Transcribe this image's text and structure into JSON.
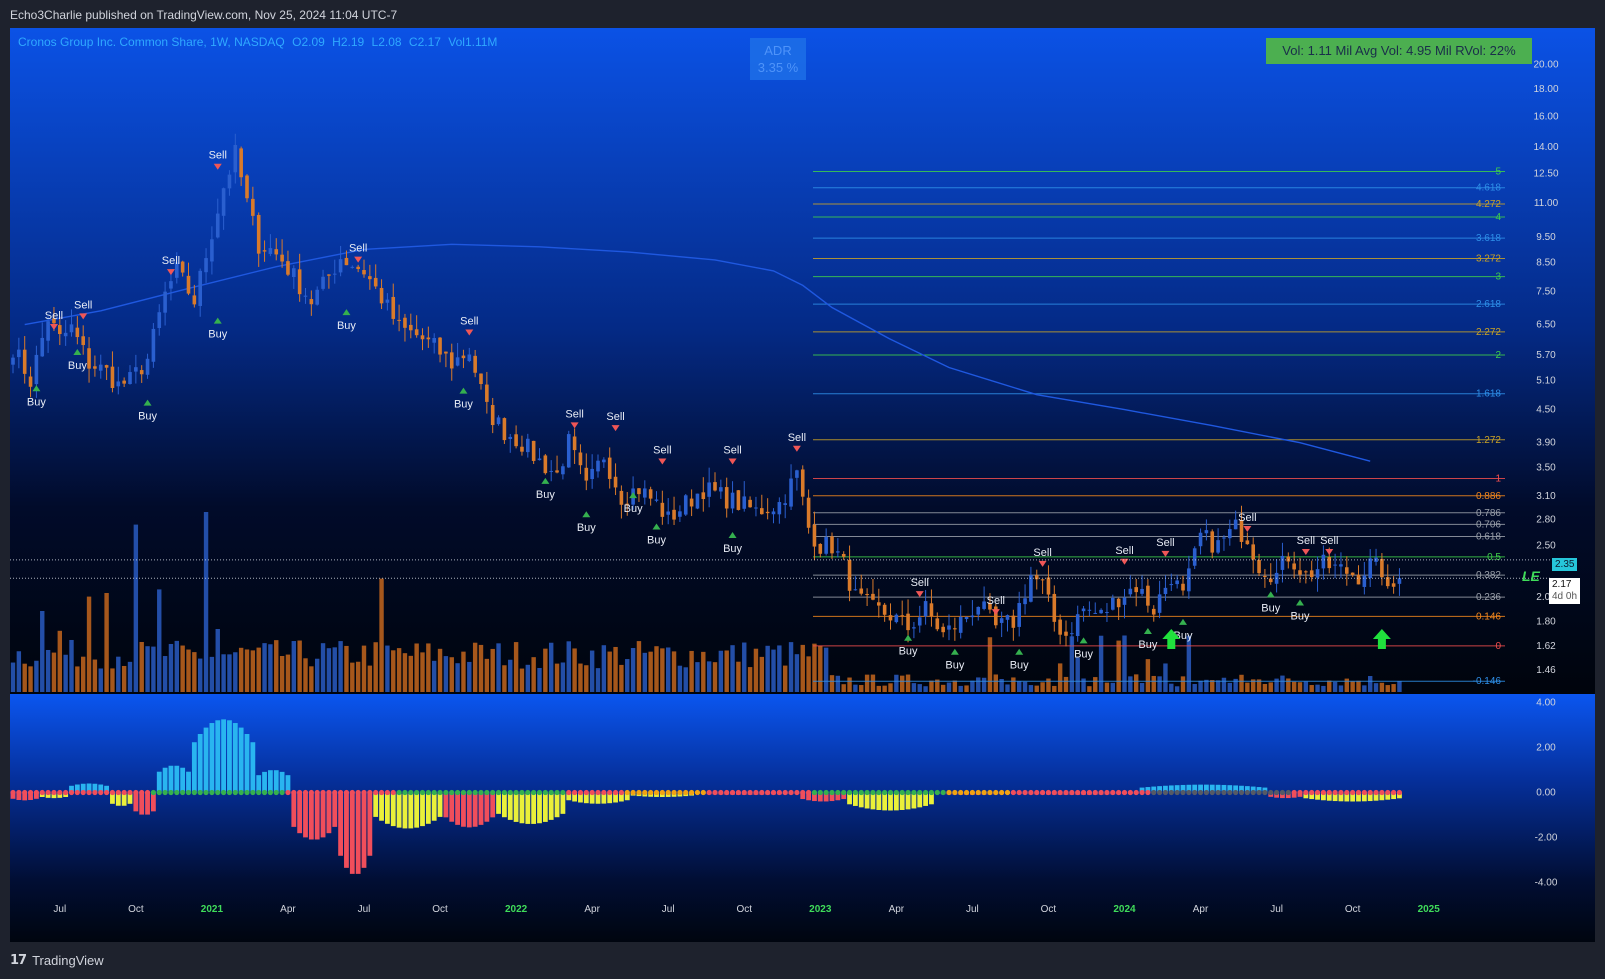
{
  "header": {
    "publisher": "Echo3Charlie published on TradingView.com, Nov 25, 2024 11:04 UTC-7"
  },
  "legend": {
    "symbol": "Cronos Group Inc. Common Share, 1W, NASDAQ",
    "open": "O2.09",
    "high": "H2.19",
    "low": "L2.08",
    "close": "C2.17",
    "volume": "Vol1.11M"
  },
  "adr": {
    "label": "ADR",
    "value": "3.35 %"
  },
  "volume_box": "Vol: 1.11 Mil   Avg Vol: 4.95 Mil   RVol: 22%",
  "footer": {
    "brand_logo": "17",
    "brand_name": "TradingView"
  },
  "price_badges": {
    "upper": "2.35",
    "last": "2.17",
    "countdown": "4d 0h",
    "le": "LE"
  },
  "colors": {
    "background_top": "#0b4fe3",
    "background_bottom": "#00050f",
    "bull": "#2a5fcf",
    "bear": "#d97a2a",
    "ma": "#1f58e0",
    "sell_marker": "#f05656",
    "buy_marker": "#35b04f",
    "hist_blue": "#29b5f0",
    "hist_red": "#f04e5b",
    "hist_yellow": "#eaf03a"
  },
  "chart_data": [
    {
      "type": "candlestick",
      "title": "Cronos Group Inc. Common Share, 1W, NASDAQ",
      "y_scale": "log",
      "ylim": [
        1.35,
        21.5
      ],
      "y_ticks": [
        "20.00",
        "18.00",
        "16.00",
        "14.00",
        "12.50",
        "11.00",
        "9.50",
        "8.50",
        "7.50",
        "6.50",
        "5.70",
        "5.10",
        "4.50",
        "3.90",
        "3.50",
        "3.10",
        "2.80",
        "2.50",
        "2.00",
        "1.80",
        "1.62",
        "1.46"
      ],
      "x_ticks": [
        {
          "label": "Jul",
          "week": 8,
          "year": false
        },
        {
          "label": "Oct",
          "week": 21,
          "year": false
        },
        {
          "label": "2021",
          "week": 34,
          "year": true
        },
        {
          "label": "Apr",
          "week": 47,
          "year": false
        },
        {
          "label": "Jul",
          "week": 60,
          "year": false
        },
        {
          "label": "Oct",
          "week": 73,
          "year": false
        },
        {
          "label": "2022",
          "week": 86,
          "year": true
        },
        {
          "label": "Apr",
          "week": 99,
          "year": false
        },
        {
          "label": "Jul",
          "week": 112,
          "year": false
        },
        {
          "label": "Oct",
          "week": 125,
          "year": false
        },
        {
          "label": "2023",
          "week": 138,
          "year": true
        },
        {
          "label": "Apr",
          "week": 151,
          "year": false
        },
        {
          "label": "Jul",
          "week": 164,
          "year": false
        },
        {
          "label": "Oct",
          "week": 177,
          "year": false
        },
        {
          "label": "2024",
          "week": 190,
          "year": true
        },
        {
          "label": "Apr",
          "week": 203,
          "year": false
        },
        {
          "label": "Jul",
          "week": 216,
          "year": false
        },
        {
          "label": "Oct",
          "week": 229,
          "year": false
        },
        {
          "label": "2025",
          "week": 242,
          "year": true
        }
      ],
      "anchors": [
        [
          0,
          5.9
        ],
        [
          3,
          5.1
        ],
        [
          6,
          6.7
        ],
        [
          8,
          6.1
        ],
        [
          10,
          6.4
        ],
        [
          13,
          5.5
        ],
        [
          16,
          5.3
        ],
        [
          18,
          5.0
        ],
        [
          20,
          5.1
        ],
        [
          23,
          5.6
        ],
        [
          26,
          7.4
        ],
        [
          28,
          8.2
        ],
        [
          31,
          7.2
        ],
        [
          33,
          8.8
        ],
        [
          36,
          11.8
        ],
        [
          38,
          13.6
        ],
        [
          40,
          11.0
        ],
        [
          42,
          9.2
        ],
        [
          44,
          9.0
        ],
        [
          46,
          8.6
        ],
        [
          48,
          8.0
        ],
        [
          51,
          7.2
        ],
        [
          53,
          7.7
        ],
        [
          56,
          8.7
        ],
        [
          60,
          8.2
        ],
        [
          63,
          7.3
        ],
        [
          66,
          6.4
        ],
        [
          69,
          6.2
        ],
        [
          72,
          5.9
        ],
        [
          75,
          5.5
        ],
        [
          78,
          5.8
        ],
        [
          81,
          4.5
        ],
        [
          84,
          4.1
        ],
        [
          87,
          3.9
        ],
        [
          90,
          3.6
        ],
        [
          93,
          3.4
        ],
        [
          95,
          3.9
        ],
        [
          98,
          3.2
        ],
        [
          101,
          3.7
        ],
        [
          104,
          3.1
        ],
        [
          107,
          3.2
        ],
        [
          110,
          3.0
        ],
        [
          112,
          2.8
        ],
        [
          115,
          3.0
        ],
        [
          118,
          3.2
        ],
        [
          121,
          3.1
        ],
        [
          124,
          3.0
        ],
        [
          127,
          2.9
        ],
        [
          131,
          3.0
        ],
        [
          134,
          3.4
        ],
        [
          136,
          2.7
        ],
        [
          138,
          2.5
        ],
        [
          140,
          2.5
        ],
        [
          142,
          2.3
        ],
        [
          144,
          2.0
        ],
        [
          147,
          1.9
        ],
        [
          150,
          1.85
        ],
        [
          153,
          1.75
        ],
        [
          156,
          1.9
        ],
        [
          159,
          1.7
        ],
        [
          162,
          1.8
        ],
        [
          165,
          1.95
        ],
        [
          168,
          1.75
        ],
        [
          171,
          1.8
        ],
        [
          174,
          2.2
        ],
        [
          176,
          2.1
        ],
        [
          178,
          1.8
        ],
        [
          180,
          1.7
        ],
        [
          183,
          1.9
        ],
        [
          186,
          1.85
        ],
        [
          189,
          2.0
        ],
        [
          192,
          2.1
        ],
        [
          195,
          1.9
        ],
        [
          198,
          2.2
        ],
        [
          200,
          2.0
        ],
        [
          203,
          2.6
        ],
        [
          206,
          2.5
        ],
        [
          209,
          2.7
        ],
        [
          211,
          2.6
        ],
        [
          213,
          2.3
        ],
        [
          216,
          2.2
        ],
        [
          218,
          2.4
        ],
        [
          221,
          2.2
        ],
        [
          224,
          2.3
        ],
        [
          227,
          2.25
        ],
        [
          230,
          2.2
        ],
        [
          232,
          2.3
        ],
        [
          234,
          2.25
        ],
        [
          235,
          2.02
        ],
        [
          236,
          2.09
        ],
        [
          237,
          2.17
        ]
      ],
      "last_close": 2.17,
      "markers": [
        {
          "type": "sell",
          "week": 7,
          "price": 6.35
        },
        {
          "type": "sell",
          "week": 12,
          "price": 6.65
        },
        {
          "type": "sell",
          "week": 27,
          "price": 8.05
        },
        {
          "type": "sell",
          "week": 35,
          "price": 12.7
        },
        {
          "type": "sell",
          "week": 59,
          "price": 8.5
        },
        {
          "type": "sell",
          "week": 78,
          "price": 6.2
        },
        {
          "type": "sell",
          "week": 96,
          "price": 4.15
        },
        {
          "type": "sell",
          "week": 103,
          "price": 4.1
        },
        {
          "type": "sell",
          "week": 111,
          "price": 3.55
        },
        {
          "type": "sell",
          "week": 123,
          "price": 3.55
        },
        {
          "type": "sell",
          "week": 134,
          "price": 3.75
        },
        {
          "type": "sell",
          "week": 155,
          "price": 2.0
        },
        {
          "type": "sell",
          "week": 168,
          "price": 1.85
        },
        {
          "type": "sell",
          "week": 176,
          "price": 2.28
        },
        {
          "type": "sell",
          "week": 190,
          "price": 2.3
        },
        {
          "type": "sell",
          "week": 197,
          "price": 2.38
        },
        {
          "type": "sell",
          "week": 211,
          "price": 2.65
        },
        {
          "type": "sell",
          "week": 221,
          "price": 2.4
        },
        {
          "type": "sell",
          "week": 225,
          "price": 2.4
        },
        {
          "type": "buy",
          "week": 4,
          "price": 5.0
        },
        {
          "type": "buy",
          "week": 11,
          "price": 5.85
        },
        {
          "type": "buy",
          "week": 23,
          "price": 4.7
        },
        {
          "type": "buy",
          "week": 35,
          "price": 6.7
        },
        {
          "type": "buy",
          "week": 57,
          "price": 6.95
        },
        {
          "type": "buy",
          "week": 77,
          "price": 4.95
        },
        {
          "type": "buy",
          "week": 91,
          "price": 3.35
        },
        {
          "type": "buy",
          "week": 98,
          "price": 2.9
        },
        {
          "type": "buy",
          "week": 106,
          "price": 3.15
        },
        {
          "type": "buy",
          "week": 110,
          "price": 2.75
        },
        {
          "type": "buy",
          "week": 123,
          "price": 2.65
        },
        {
          "type": "buy",
          "week": 153,
          "price": 1.7
        },
        {
          "type": "buy",
          "week": 161,
          "price": 1.6
        },
        {
          "type": "buy",
          "week": 172,
          "price": 1.6
        },
        {
          "type": "buy",
          "week": 183,
          "price": 1.68
        },
        {
          "type": "buy",
          "week": 194,
          "price": 1.75
        },
        {
          "type": "buy",
          "week": 200,
          "price": 1.82
        },
        {
          "type": "buy",
          "week": 215,
          "price": 2.05
        },
        {
          "type": "buy",
          "week": 220,
          "price": 1.98
        }
      ],
      "buy_arrows_big": [
        {
          "week": 198,
          "price": 1.64
        },
        {
          "week": 234,
          "price": 1.64
        }
      ],
      "moving_average": [
        [
          2,
          6.5
        ],
        [
          15,
          6.9
        ],
        [
          30,
          7.6
        ],
        [
          45,
          8.35
        ],
        [
          60,
          9.0
        ],
        [
          75,
          9.2
        ],
        [
          90,
          9.1
        ],
        [
          105,
          8.9
        ],
        [
          120,
          8.6
        ],
        [
          130,
          8.2
        ],
        [
          135,
          7.7
        ],
        [
          140,
          7.0
        ],
        [
          150,
          6.1
        ],
        [
          160,
          5.4
        ],
        [
          175,
          4.8
        ],
        [
          190,
          4.5
        ],
        [
          205,
          4.2
        ],
        [
          220,
          3.9
        ],
        [
          232,
          3.6
        ]
      ],
      "fib_levels": [
        {
          "label": "0",
          "price": 1.62,
          "color": "#f04e4e"
        },
        {
          "label": "0.146",
          "price": 1.84,
          "color": "#f2871d"
        },
        {
          "label": "0.236",
          "price": 2.0,
          "color": "#9aa0aa"
        },
        {
          "label": "0.382",
          "price": 2.2,
          "color": "#9aa0aa"
        },
        {
          "label": "0.5",
          "price": 2.38,
          "color": "#3fcf4a"
        },
        {
          "label": "0.618",
          "price": 2.6,
          "color": "#9aa0aa"
        },
        {
          "label": "0.706",
          "price": 2.74,
          "color": "#9aa0aa"
        },
        {
          "label": "0.786",
          "price": 2.88,
          "color": "#9aa0aa"
        },
        {
          "label": "0.886",
          "price": 3.1,
          "color": "#f2871d"
        },
        {
          "label": "1",
          "price": 3.34,
          "color": "#f04e4e"
        },
        {
          "label": "1.272",
          "price": 3.95,
          "color": "#c9a227"
        },
        {
          "label": "1.618",
          "price": 4.82,
          "color": "#2e8fe8"
        },
        {
          "label": "2",
          "price": 5.7,
          "color": "#3fcf4a"
        },
        {
          "label": "2.272",
          "price": 6.3,
          "color": "#c9a227"
        },
        {
          "label": "2.618",
          "price": 7.1,
          "color": "#2e8fe8"
        },
        {
          "label": "3",
          "price": 8.0,
          "color": "#3fcf4a"
        },
        {
          "label": "3.272",
          "price": 8.65,
          "color": "#c9a227"
        },
        {
          "label": "3.618",
          "price": 9.45,
          "color": "#2e8fe8"
        },
        {
          "label": "4",
          "price": 10.35,
          "color": "#3fcf4a"
        },
        {
          "label": "4.272",
          "price": 10.95,
          "color": "#c9a227"
        },
        {
          "label": "4.618",
          "price": 11.75,
          "color": "#2e8fe8"
        },
        {
          "label": "5",
          "price": 12.6,
          "color": "#3fcf4a"
        },
        {
          "label": "-0.146",
          "price": 1.39,
          "color": "#2e8fe8"
        }
      ],
      "volume_spikes": [
        [
          21,
          0.93
        ],
        [
          33,
          1.0
        ],
        [
          63,
          0.63
        ],
        [
          25,
          0.57
        ],
        [
          16,
          0.55
        ],
        [
          13,
          0.53
        ],
        [
          35,
          0.35
        ],
        [
          5,
          0.45
        ],
        [
          8,
          0.34
        ]
      ]
    },
    {
      "type": "histogram",
      "ylim": [
        -4.6,
        4.2
      ],
      "y_ticks": [
        "4.00",
        "2.00",
        "0.00",
        "-2.00",
        "-4.00"
      ],
      "segments": [
        {
          "from": 0,
          "to": 4,
          "color": "red",
          "val": -0.35
        },
        {
          "from": 5,
          "to": 9,
          "color": "yellow",
          "val": -0.25
        },
        {
          "from": 10,
          "to": 16,
          "color": "blue",
          "val": 0.4
        },
        {
          "from": 17,
          "to": 20,
          "color": "yellow",
          "val": -0.6
        },
        {
          "from": 21,
          "to": 24,
          "color": "red",
          "val": -1.0
        },
        {
          "from": 25,
          "to": 30,
          "color": "blue",
          "val": 1.2
        },
        {
          "from": 31,
          "to": 41,
          "color": "blue",
          "val": 3.25
        },
        {
          "from": 42,
          "to": 47,
          "color": "blue",
          "val": 1.0
        },
        {
          "from": 48,
          "to": 55,
          "color": "red",
          "val": -2.1
        },
        {
          "from": 56,
          "to": 61,
          "color": "red",
          "val": -3.65
        },
        {
          "from": 62,
          "to": 73,
          "color": "yellow",
          "val": -1.6
        },
        {
          "from": 74,
          "to": 82,
          "color": "red",
          "val": -1.55
        },
        {
          "from": 83,
          "to": 94,
          "color": "yellow",
          "val": -1.4
        },
        {
          "from": 95,
          "to": 105,
          "color": "yellow",
          "val": -0.5
        },
        {
          "from": 106,
          "to": 116,
          "color": "yellow",
          "val": -0.2
        },
        {
          "from": 117,
          "to": 134,
          "color": "red",
          "val": -0.1
        },
        {
          "from": 135,
          "to": 142,
          "color": "red",
          "val": -0.4
        },
        {
          "from": 143,
          "to": 157,
          "color": "yellow",
          "val": -0.8
        },
        {
          "from": 158,
          "to": 170,
          "color": "red",
          "val": -0.1
        },
        {
          "from": 171,
          "to": 192,
          "color": "red",
          "val": -0.1
        },
        {
          "from": 193,
          "to": 214,
          "color": "blue",
          "val": 0.35
        },
        {
          "from": 215,
          "to": 220,
          "color": "red",
          "val": -0.25
        },
        {
          "from": 221,
          "to": 237,
          "color": "yellow",
          "val": -0.4
        }
      ],
      "dots": [
        {
          "from": 0,
          "to": 23,
          "color": "#f04e5b"
        },
        {
          "from": 24,
          "to": 46,
          "color": "#35b04f"
        },
        {
          "from": 47,
          "to": 65,
          "color": "#f04e5b"
        },
        {
          "from": 66,
          "to": 94,
          "color": "#35b04f"
        },
        {
          "from": 95,
          "to": 104,
          "color": "#f04e5b"
        },
        {
          "from": 105,
          "to": 118,
          "color": "#f2a313"
        },
        {
          "from": 119,
          "to": 136,
          "color": "#f04e5b"
        },
        {
          "from": 137,
          "to": 159,
          "color": "#35b04f"
        },
        {
          "from": 160,
          "to": 170,
          "color": "#f2a313"
        },
        {
          "from": 171,
          "to": 194,
          "color": "#f04e5b"
        },
        {
          "from": 195,
          "to": 218,
          "color": "#555a66"
        },
        {
          "from": 219,
          "to": 237,
          "color": "#f04e5b"
        }
      ]
    }
  ]
}
